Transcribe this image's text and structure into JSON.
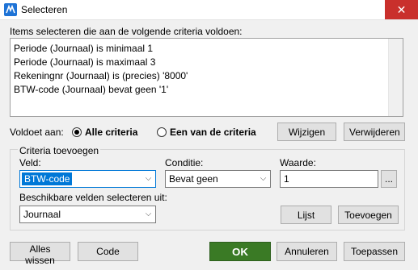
{
  "window": {
    "title": "Selecteren",
    "close_glyph": "✕"
  },
  "intro_label": "Items selecteren die aan de volgende criteria voldoen:",
  "criteria_list": [
    "Periode (Journaal) is minimaal 1",
    "Periode (Journaal) is maximaal 3",
    "Rekeningnr (Journaal) is (precies) '8000'",
    "BTW-code (Journaal) bevat geen '1'"
  ],
  "match": {
    "label": "Voldoet aan:",
    "options": [
      "Alle criteria",
      "Een van de criteria"
    ],
    "selected": "Alle criteria"
  },
  "buttons": {
    "edit": "Wijzigen",
    "remove": "Verwijderen",
    "browse": "...",
    "list": "Lijst",
    "add": "Toevoegen",
    "clear_all": "Alles wissen",
    "code": "Code",
    "ok": "OK",
    "cancel": "Annuleren",
    "apply": "Toepassen"
  },
  "criteria_add": {
    "group_title": "Criteria toevoegen",
    "field_label": "Veld:",
    "field_value": "BTW-code",
    "condition_label": "Conditie:",
    "condition_value": "Bevat geen",
    "value_label": "Waarde:",
    "value_value": "1",
    "available_label": "Beschikbare velden selecteren uit:",
    "available_value": "Journaal"
  },
  "colors": {
    "ok_button": "#3a7a25",
    "close_button": "#c9302c",
    "focus": "#0078d7"
  },
  "icons": {
    "app": "app-icon",
    "dropdown": "chevron-down-icon"
  }
}
